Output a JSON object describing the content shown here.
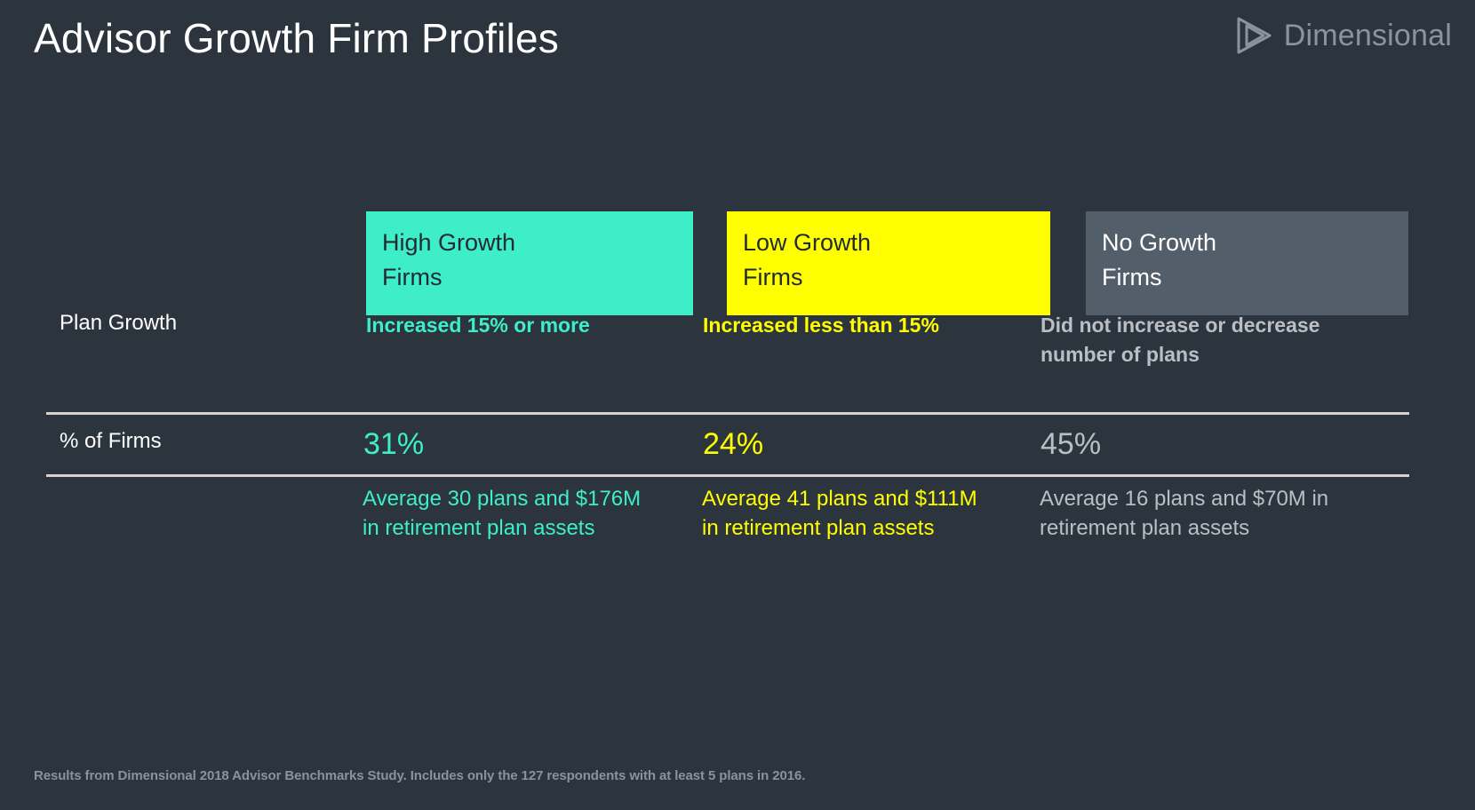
{
  "slide": {
    "title": "Advisor Growth Firm Profiles",
    "footnote": "Results from Dimensional 2018 Advisor Benchmarks Study. Includes only the 127 respondents with at least 5 plans in 2016."
  },
  "brand": {
    "name": "Dimensional",
    "mark_icon": "triangle-play-outline-icon",
    "color": "#8b949d"
  },
  "colors": {
    "background": "#2c353e",
    "high_growth": "#3eeec9",
    "low_growth": "#ffff00",
    "no_growth": "#525e6a",
    "no_growth_text": "#b9bfc5",
    "divider": "#d6d3cc"
  },
  "row_labels": {
    "plan_growth": "Plan Growth",
    "pct_of_firms": "% of Firms"
  },
  "columns": [
    {
      "header_line1": "High Growth",
      "header_line2": "Firms",
      "plan_growth": "Increased 15% or more",
      "pct_of_firms": "31%",
      "detail": "Average 30 plans and $176M in retirement plan assets",
      "accent": "#3eeec9"
    },
    {
      "header_line1": "Low Growth",
      "header_line2": "Firms",
      "plan_growth": "Increased less than 15%",
      "pct_of_firms": "24%",
      "detail": "Average 41 plans and $111M in retirement plan assets",
      "accent": "#ffff00"
    },
    {
      "header_line1": "No Growth",
      "header_line2": "Firms",
      "plan_growth": "Did not increase or decrease number of plans",
      "pct_of_firms": "45%",
      "detail": "Average 16 plans and $70M in retirement plan assets",
      "accent": "#b9bfc5"
    }
  ]
}
